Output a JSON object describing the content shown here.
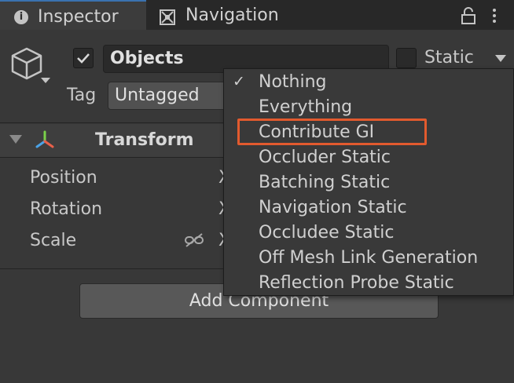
{
  "tabs": [
    {
      "label": "Inspector",
      "icon": "info-icon",
      "active": true
    },
    {
      "label": "Navigation",
      "icon": "navigation-icon",
      "active": false
    }
  ],
  "object": {
    "name": "Objects",
    "active": true,
    "static_label": "Static",
    "static_checked": false,
    "tag_label": "Tag",
    "tag_value": "Untagged"
  },
  "component": {
    "title": "Transform",
    "properties": [
      {
        "label": "Position",
        "axis": "X"
      },
      {
        "label": "Rotation",
        "axis": "X"
      },
      {
        "label": "Scale",
        "axis": "X"
      }
    ]
  },
  "add_component_label": "Add Component",
  "static_menu": {
    "items": [
      {
        "label": "Nothing",
        "checked": true
      },
      {
        "label": "Everything",
        "checked": false
      },
      {
        "label": "Contribute GI",
        "checked": false,
        "highlighted": true
      },
      {
        "label": "Occluder Static",
        "checked": false
      },
      {
        "label": "Batching Static",
        "checked": false
      },
      {
        "label": "Navigation Static",
        "checked": false
      },
      {
        "label": "Occludee Static",
        "checked": false
      },
      {
        "label": "Off Mesh Link Generation",
        "checked": false
      },
      {
        "label": "Reflection Probe Static",
        "checked": false
      }
    ]
  },
  "colors": {
    "highlight": "#e25a2e",
    "accent": "#3a72b0",
    "background": "#383838"
  }
}
